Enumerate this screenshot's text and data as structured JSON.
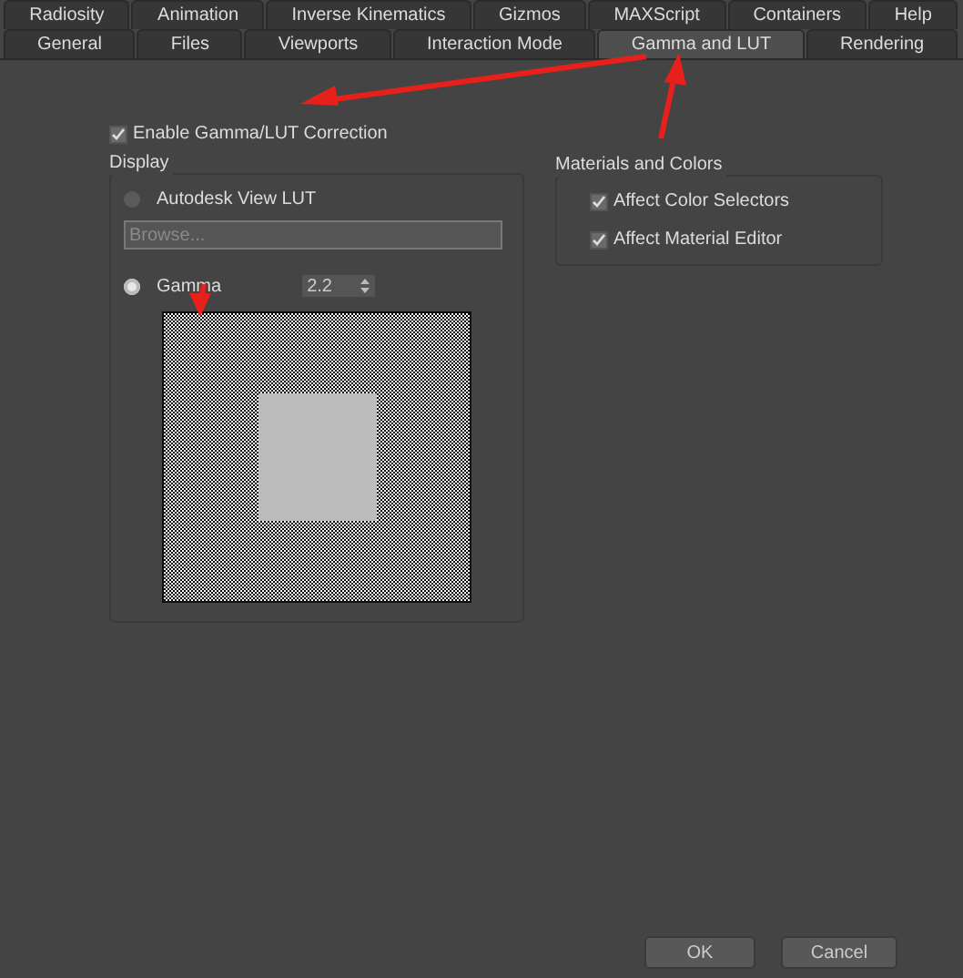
{
  "tab_rows": [
    [
      {
        "label": "Radiosity",
        "selected": false
      },
      {
        "label": "Animation",
        "selected": false
      },
      {
        "label": "Inverse Kinematics",
        "selected": false
      },
      {
        "label": "Gizmos",
        "selected": false
      },
      {
        "label": "MAXScript",
        "selected": false
      },
      {
        "label": "Containers",
        "selected": false
      },
      {
        "label": "Help",
        "selected": false
      }
    ],
    [
      {
        "label": "General",
        "selected": false
      },
      {
        "label": "Files",
        "selected": false
      },
      {
        "label": "Viewports",
        "selected": false
      },
      {
        "label": "Interaction Mode",
        "selected": false
      },
      {
        "label": "Gamma and LUT",
        "selected": true
      },
      {
        "label": "Rendering",
        "selected": false
      }
    ]
  ],
  "enable_checkbox": {
    "label": "Enable Gamma/LUT Correction",
    "checked": true
  },
  "display": {
    "title": "Display",
    "lut_radio": {
      "label": "Autodesk View LUT",
      "selected": false
    },
    "browse_field": {
      "placeholder": "Browse...",
      "disabled": true
    },
    "gamma_radio": {
      "label": "Gamma",
      "selected": true
    },
    "gamma_value": "2.2"
  },
  "materials": {
    "title": "Materials and Colors",
    "options": [
      {
        "label": "Affect Color Selectors",
        "checked": true
      },
      {
        "label": "Affect Material Editor",
        "checked": true
      }
    ]
  },
  "buttons": [
    "OK",
    "Cancel"
  ]
}
